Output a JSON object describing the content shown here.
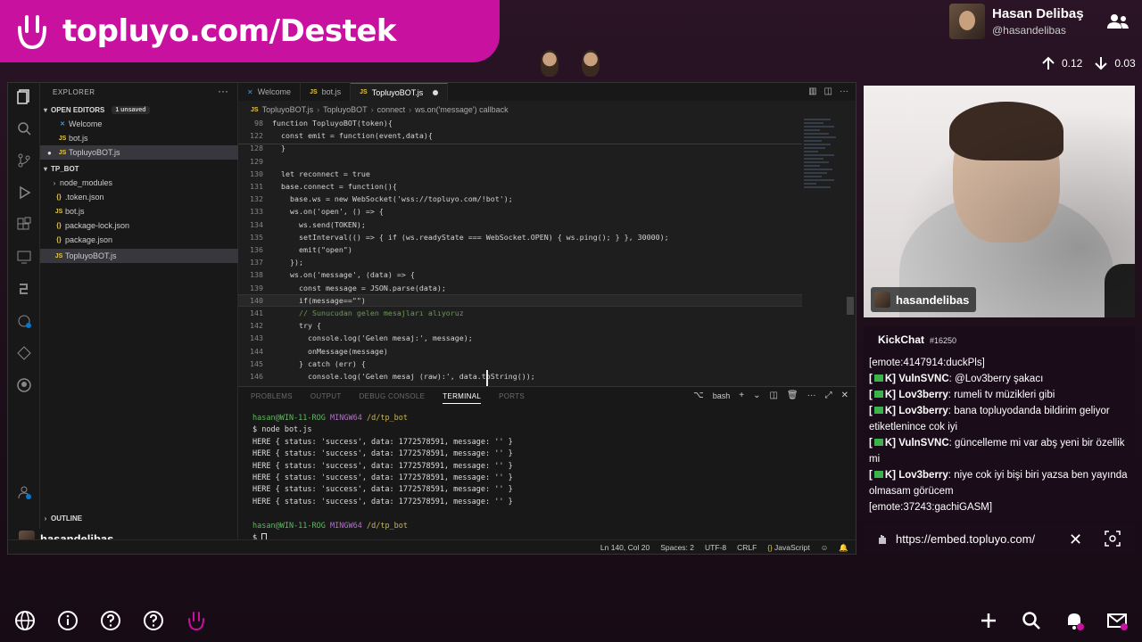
{
  "banner": {
    "text": "topluyo.com/Destek"
  },
  "profile": {
    "name": "Hasan Delibaş",
    "handle": "@hasandelibas"
  },
  "stats": {
    "up": "0.12",
    "down": "0.03"
  },
  "vscode": {
    "explorer_title": "EXPLORER",
    "open_editors": "OPEN EDITORS",
    "unsaved_badge": "1 unsaved",
    "open_files": [
      "Welcome",
      "bot.js",
      "TopluyoBOT.js"
    ],
    "project": "TP_BOT",
    "files": [
      "node_modules",
      ".token.json",
      "bot.js",
      "package-lock.json",
      "package.json",
      "TopluyoBOT.js"
    ],
    "outline": "OUTLINE",
    "user_chip": "hasandelibas",
    "tabs": [
      "Welcome",
      "bot.js",
      "TopluyoBOT.js"
    ],
    "breadcrumb": [
      "TopluyoBOT.js",
      "TopluyoBOT",
      "connect",
      "ws.on('message') callback"
    ],
    "code_lines": [
      {
        "n": "98",
        "t": "function TopluyoBOT(token){"
      },
      {
        "n": "122",
        "t": "  const emit = function(event,data){"
      },
      {
        "n": "128",
        "t": "  }"
      },
      {
        "n": "129",
        "t": ""
      },
      {
        "n": "130",
        "t": "  let reconnect = true"
      },
      {
        "n": "131",
        "t": "  base.connect = function(){"
      },
      {
        "n": "132",
        "t": "    base.ws = new WebSocket('wss://topluyo.com/!bot');"
      },
      {
        "n": "133",
        "t": "    ws.on('open', () => {"
      },
      {
        "n": "134",
        "t": "      ws.send(TOKEN);"
      },
      {
        "n": "135",
        "t": "      setInterval(() => { if (ws.readyState === WebSocket.OPEN) { ws.ping(); } }, 30000);"
      },
      {
        "n": "136",
        "t": "      emit(\"open\")"
      },
      {
        "n": "137",
        "t": "    });"
      },
      {
        "n": "138",
        "t": "    ws.on('message', (data) => {"
      },
      {
        "n": "139",
        "t": "      const message = JSON.parse(data);"
      },
      {
        "n": "140",
        "t": "      if(message==\"\")"
      },
      {
        "n": "141",
        "t": "      // Sunucudan gelen mesajları alıyoruz"
      },
      {
        "n": "142",
        "t": "      try {"
      },
      {
        "n": "143",
        "t": "        console.log('Gelen mesaj:', message);"
      },
      {
        "n": "144",
        "t": "        onMessage(message)"
      },
      {
        "n": "145",
        "t": "      } catch (err) {"
      },
      {
        "n": "146",
        "t": "        console.log('Gelen mesaj (raw):', data.toString());"
      }
    ],
    "panel_tabs": [
      "PROBLEMS",
      "OUTPUT",
      "DEBUG CONSOLE",
      "TERMINAL",
      "PORTS"
    ],
    "shell": "bash",
    "terminal": {
      "prompt_user": "hasan@WIN-11-ROG",
      "prompt_env": "MINGW64",
      "prompt_path": "/d/tp_bot",
      "command": "$ node bot.js",
      "output_lines": [
        "HERE { status: 'success', data: 1772578591, message: '' }",
        "HERE { status: 'success', data: 1772578591, message: '' }",
        "HERE { status: 'success', data: 1772578591, message: '' }",
        "HERE { status: 'success', data: 1772578591, message: '' }",
        "HERE { status: 'success', data: 1772578591, message: '' }",
        "HERE { status: 'success', data: 1772578591, message: '' }"
      ],
      "last_prompt": "$ "
    },
    "status": {
      "position": "Ln 140, Col 20",
      "spaces": "Spaces: 2",
      "encoding": "UTF-8",
      "eol": "CRLF",
      "language": "JavaScript"
    }
  },
  "webcam": {
    "name_tag": "hasandelibas"
  },
  "chat": {
    "title": "KickChat",
    "id": "#16250",
    "messages": [
      {
        "tag": "",
        "user": "",
        "text": "[emote:4147914:duckPls]"
      },
      {
        "tag": "[",
        "user": "VulnSVNC",
        "text": "@Lov3berry şakacı"
      },
      {
        "tag": "[",
        "user": "Lov3berry",
        "text": "rumeli tv müzikleri gibi"
      },
      {
        "tag": "[",
        "user": "Lov3berry",
        "text": "bana topluyodanda bildirim geliyor etiketlenince cok iyi"
      },
      {
        "tag": "[",
        "user": "VulnSVNC",
        "text": "güncelleme mi var abş yeni bir özellik mi"
      },
      {
        "tag": "[",
        "user": "Lov3berry",
        "text": "niye cok iyi bişi biri yazsa ben yayında olmasam görücem"
      },
      {
        "tag": "",
        "user": "",
        "text": "[emote:37243:gachiGASM]"
      }
    ]
  },
  "urlbar": {
    "url": "https://embed.topluyo.com/"
  },
  "colors": {
    "brand": "#c8119f",
    "editor_bg": "#1e1e1e",
    "chat_bg": "#1a0c18"
  }
}
